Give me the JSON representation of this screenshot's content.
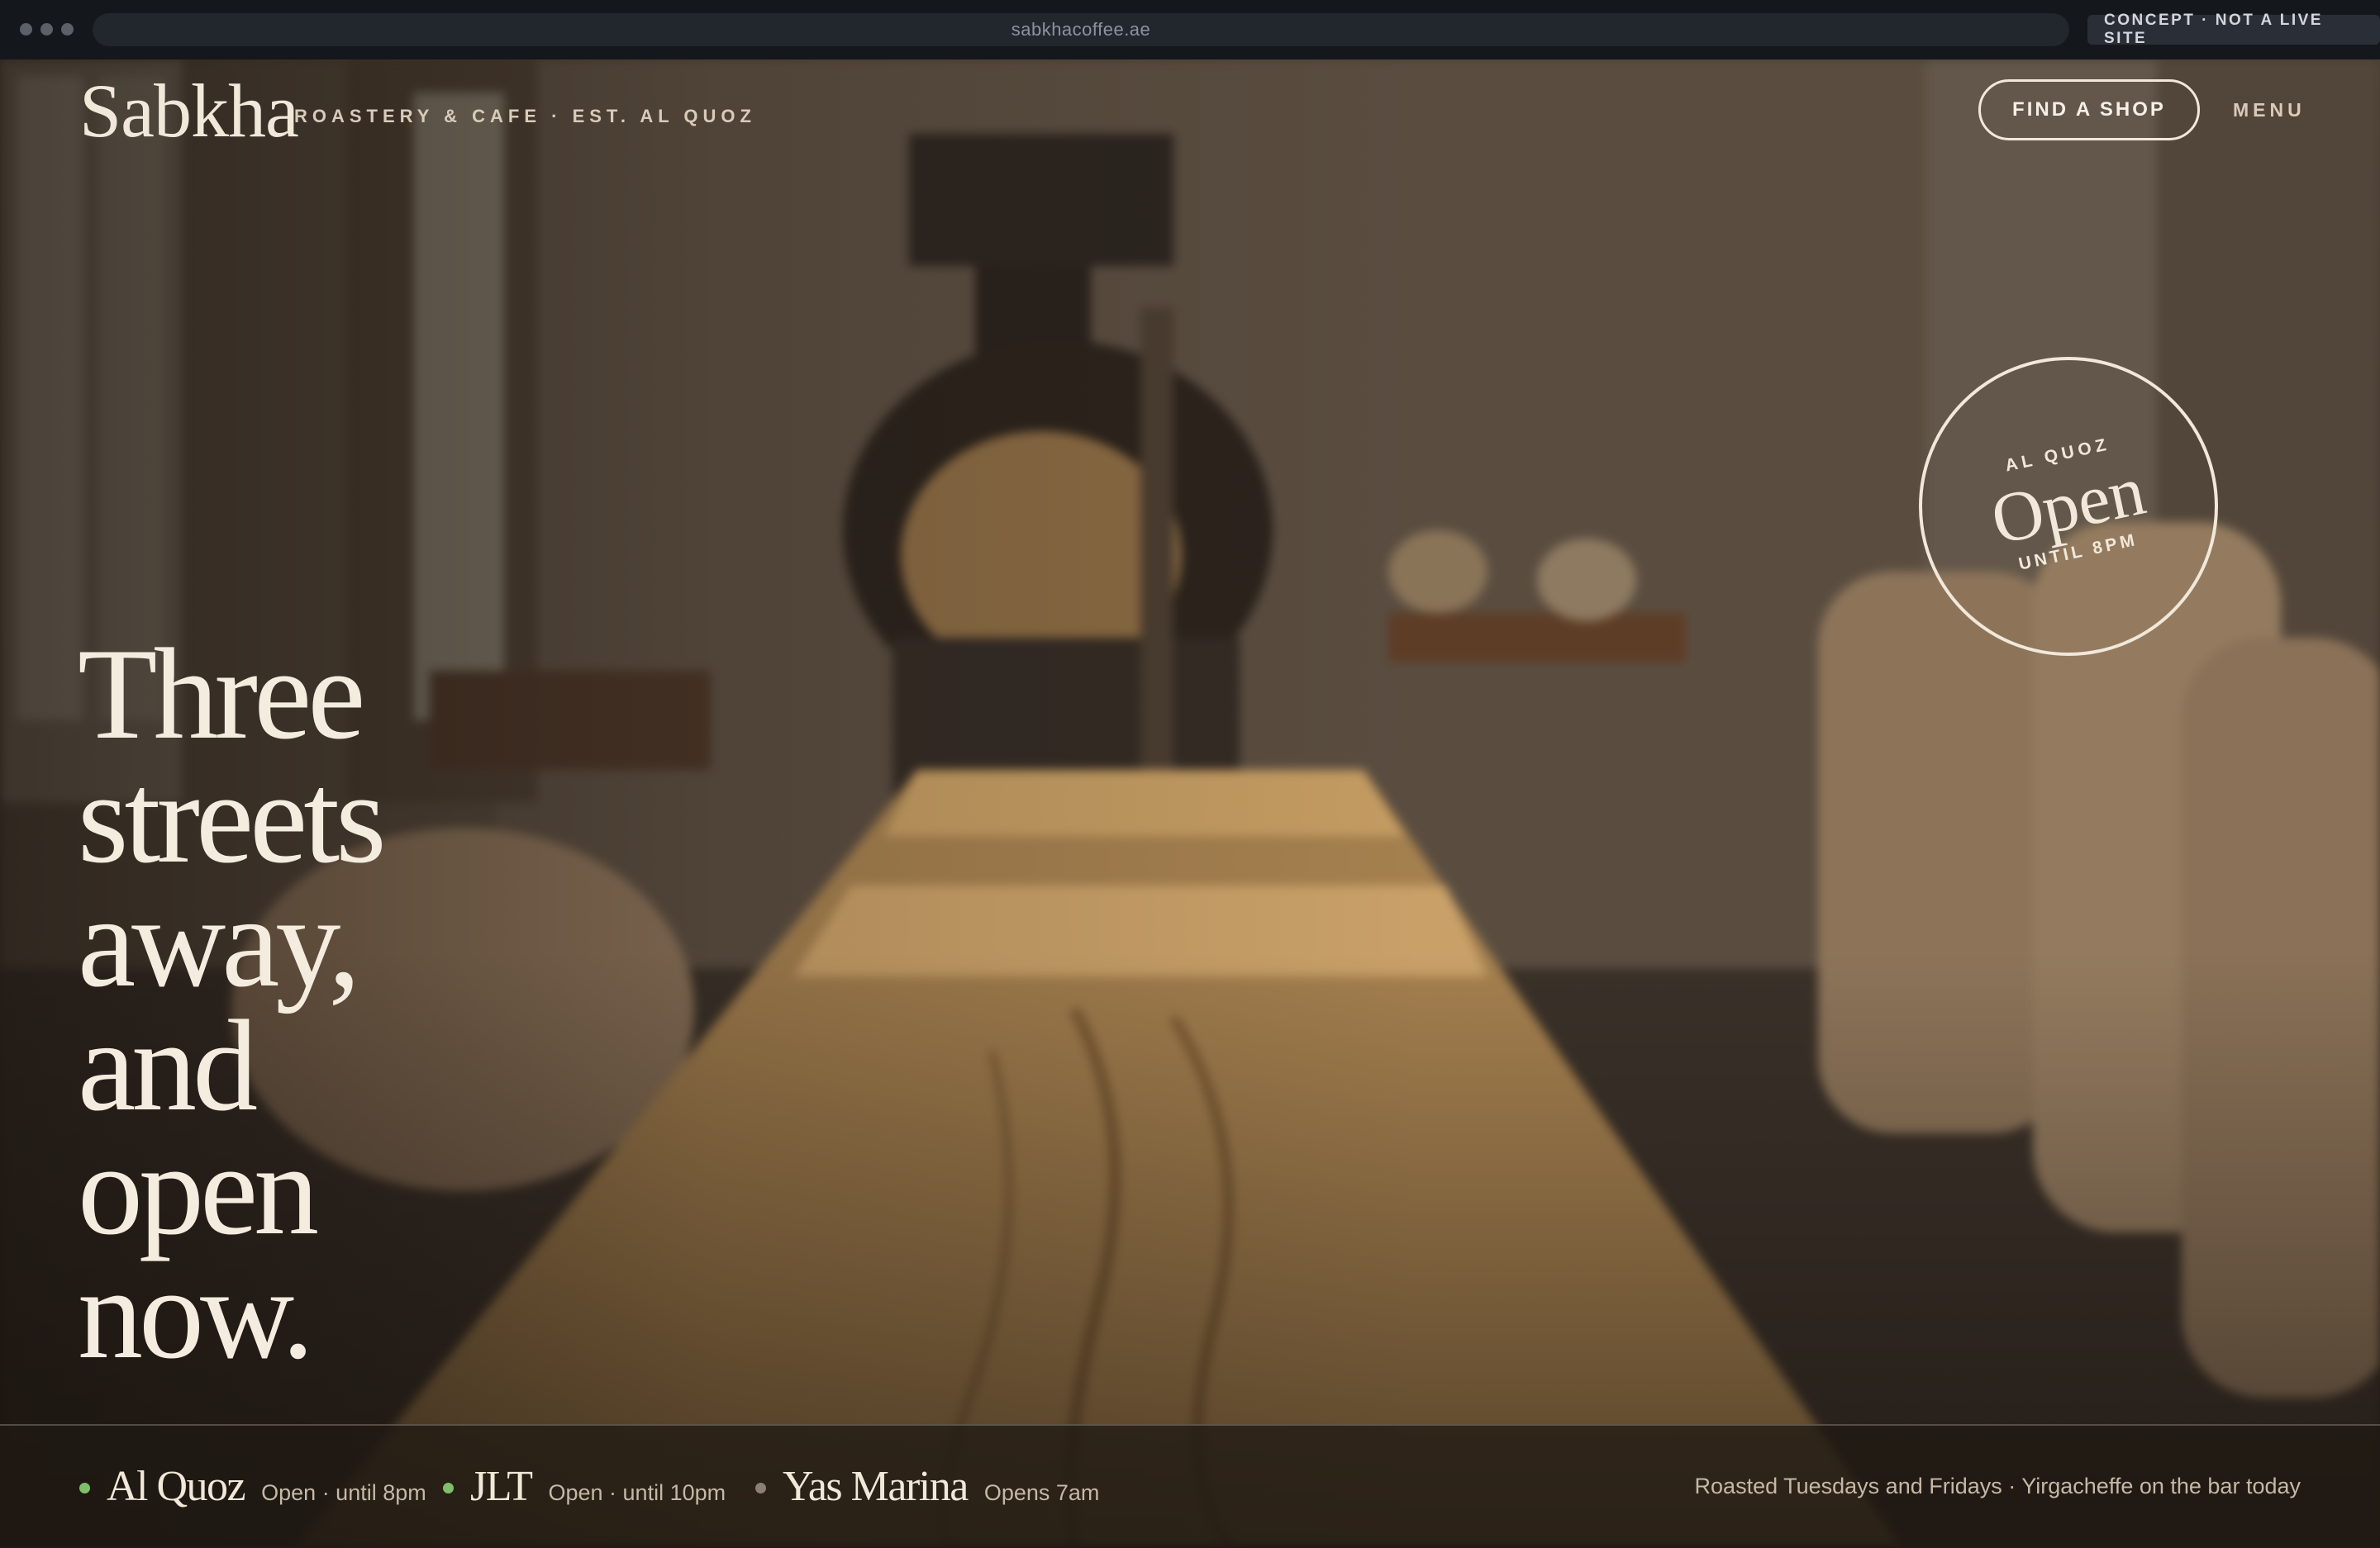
{
  "browser": {
    "url": "sabkhacoffee.ae",
    "concept_label": "CONCEPT · NOT A LIVE SITE"
  },
  "brand": {
    "logo": "Sabkha",
    "tagline": "ROASTERY & CAFE · EST. AL QUOZ"
  },
  "nav": {
    "find_shop": "FIND A SHOP",
    "menu": "MENU"
  },
  "badge": {
    "location": "AL QUOZ",
    "status": "Open",
    "until": "UNTIL 8PM"
  },
  "headline": [
    "Three",
    "streets",
    "away,",
    "and",
    "open",
    "now."
  ],
  "locations": [
    {
      "name": "Al Quoz",
      "status": "Open · until 8pm",
      "indicator_color": "#7fbf6a"
    },
    {
      "name": "JLT",
      "status": "Open · until 10pm",
      "indicator_color": "#7fbf6a"
    },
    {
      "name": "Yas Marina",
      "status": "Opens 7am",
      "indicator_color": "#8a8078"
    }
  ],
  "roast_note": "Roasted Tuesdays and Fridays · Yirgacheffe on the bar today",
  "colors": {
    "cream": "#f1e8da",
    "open_green": "#7fbf6a",
    "closed_grey": "#8a8078"
  }
}
